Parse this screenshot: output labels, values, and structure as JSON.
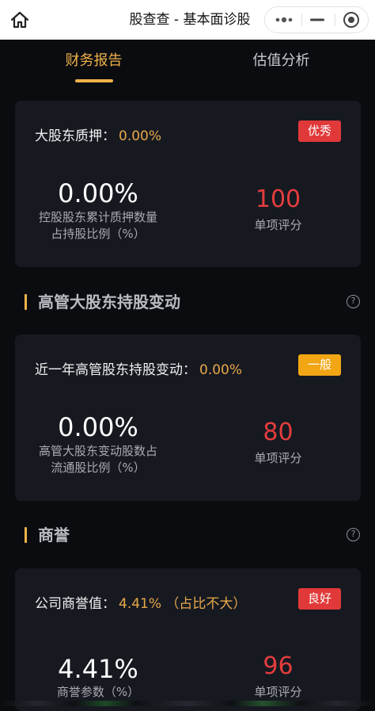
{
  "header": {
    "title": "股查查 - 基本面诊股"
  },
  "tabs": [
    {
      "label": "财务报告",
      "active": true
    },
    {
      "label": "估值分析",
      "active": false
    }
  ],
  "cards": [
    {
      "head_label": "大股东质押：",
      "head_value": "0.00%",
      "badge": "优秀",
      "metric": "0.00%",
      "metric_desc_line1": "控股股东累计质押数量",
      "metric_desc_line2": "占持股比例（%）",
      "score": "100",
      "score_label": "单项评分"
    },
    {
      "head_label": "近一年高管股东持股变动：",
      "head_value": "0.00%",
      "badge": "一般",
      "metric": "0.00%",
      "metric_desc_line1": "高管大股东变动股数占",
      "metric_desc_line2": "流通股比例（%）",
      "score": "80",
      "score_label": "单项评分"
    },
    {
      "head_label": "公司商誉值：",
      "head_value": "4.41% （占比不大）",
      "badge": "良好",
      "metric": "4.41%",
      "metric_desc_line1": "商誉参数（%）",
      "score": "96",
      "score_label": "单项评分"
    }
  ],
  "sections": [
    {
      "title": "高管大股东持股变动",
      "help": "?"
    },
    {
      "title": "商誉",
      "help": "?"
    }
  ],
  "colors": {
    "accent": "#f0b34a",
    "badge_red": "#e13939",
    "badge_orange": "#f2a614",
    "score_red": "#e43d3d"
  }
}
